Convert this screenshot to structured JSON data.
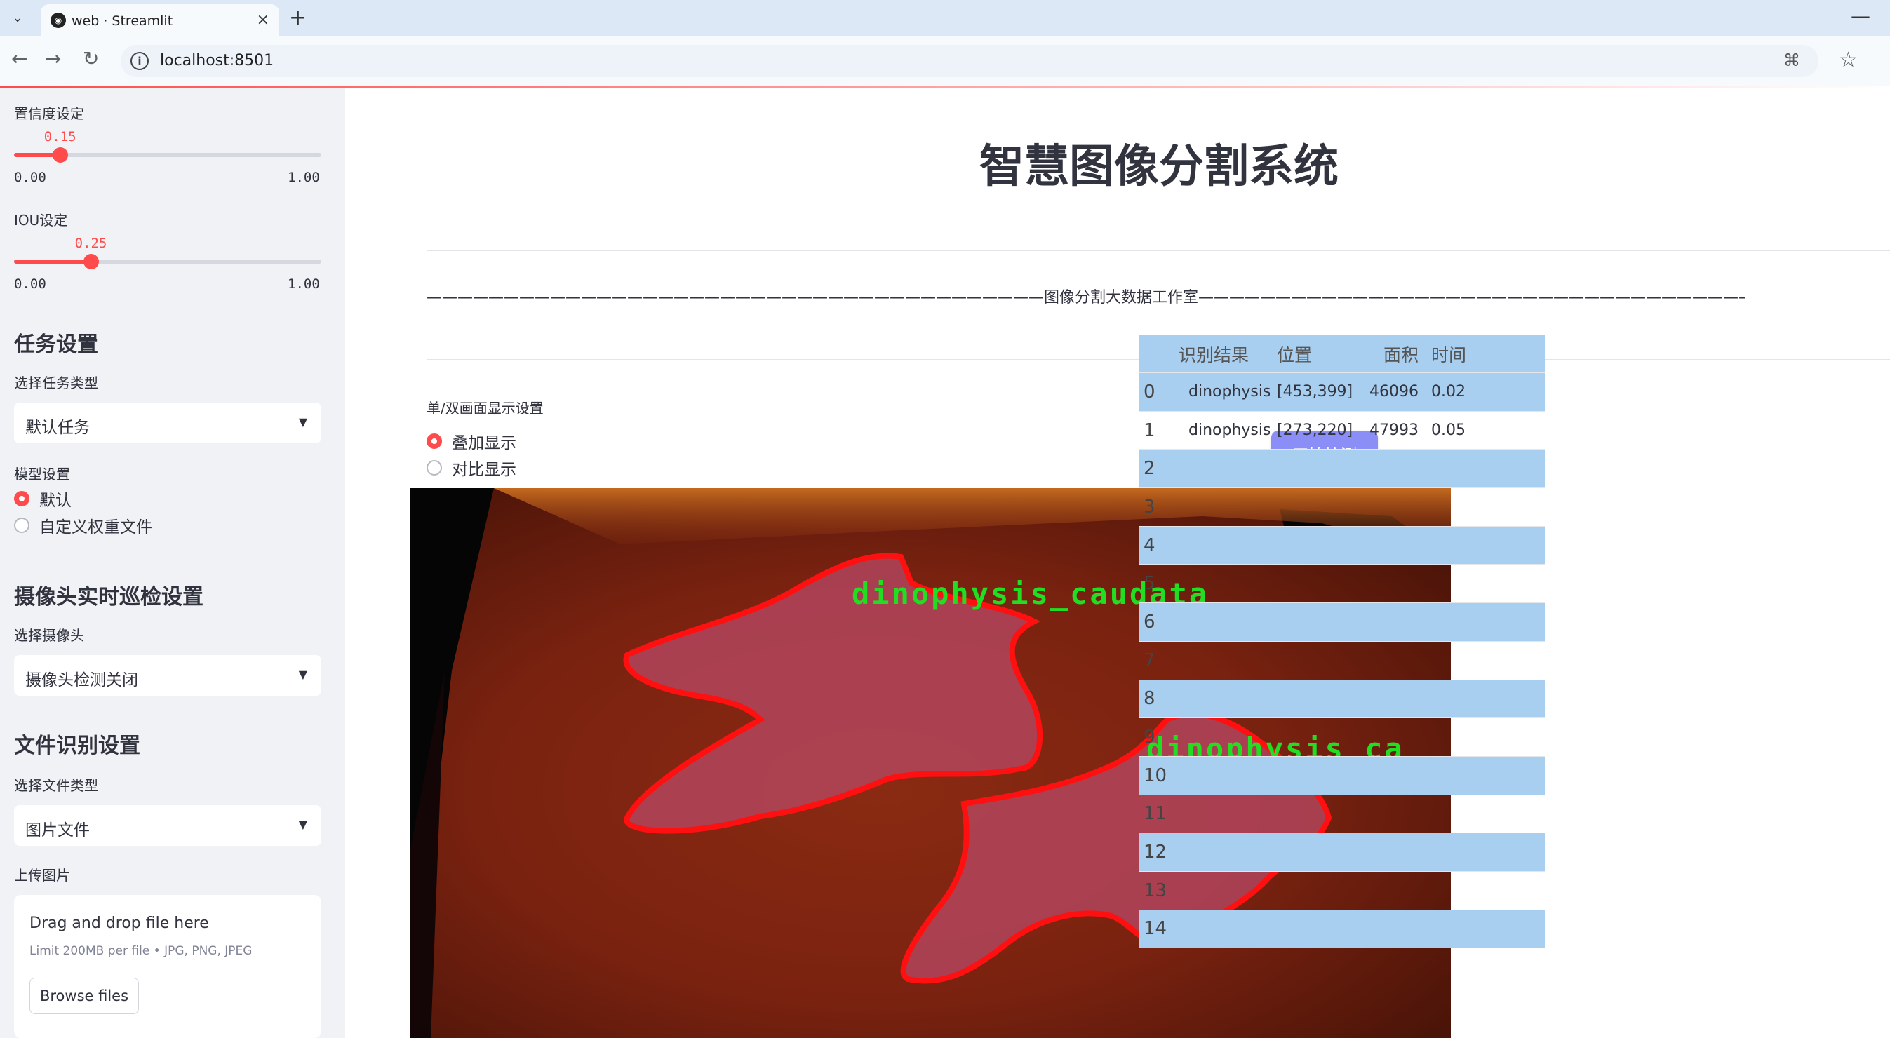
{
  "browser": {
    "tab_title": "web · Streamlit",
    "url": "localhost:8501"
  },
  "sidebar": {
    "confidence": {
      "label": "置信度设定",
      "value": 0.15,
      "value_text": "0.15",
      "min": "0.00",
      "max": "1.00"
    },
    "iou": {
      "label": "IOU设定",
      "value": 0.25,
      "value_text": "0.25",
      "min": "0.00",
      "max": "1.00"
    },
    "task_header": "任务设置",
    "task_type_label": "选择任务类型",
    "task_type_value": "默认任务",
    "model_label": "模型设置",
    "model_options": [
      "默认",
      "自定义权重文件"
    ],
    "model_selected": 0,
    "camera_header": "摄像头实时巡检设置",
    "camera_label": "选择摄像头",
    "camera_value": "摄像头检测关闭",
    "file_header": "文件识别设置",
    "file_type_label": "选择文件类型",
    "file_type_value": "图片文件",
    "upload_label": "上传图片",
    "upload_title": "Drag and drop file here",
    "upload_limit": "Limit 200MB per file • JPG, PNG, JPEG",
    "browse_label": "Browse files"
  },
  "main": {
    "title": "智慧图像分割系统",
    "banner": "————————————————————————————————————————图像分割大数据工作室————————————————————————————————————————",
    "display_label": "单/双画面显示设置",
    "display_options": [
      "叠加显示",
      "对比显示"
    ],
    "display_selected": 0,
    "start_button": "开始检测",
    "detections": [
      {
        "label": "dinophysis_caudata"
      },
      {
        "label": "dinophysis_ca"
      }
    ]
  },
  "table": {
    "headers": [
      "",
      "识别结果",
      "位置",
      "面积",
      "时间"
    ],
    "rows": [
      {
        "idx": "0",
        "result": "dinophysis_caudata",
        "position": "[453,399]",
        "area": "46096",
        "time": "0.02"
      },
      {
        "idx": "1",
        "result": "dinophysis_caudata",
        "position": "[273,220]",
        "area": "47993",
        "time": "0.05"
      },
      {
        "idx": "2",
        "result": "",
        "position": "",
        "area": "",
        "time": ""
      },
      {
        "idx": "3",
        "result": "",
        "position": "",
        "area": "",
        "time": ""
      },
      {
        "idx": "4",
        "result": "",
        "position": "",
        "area": "",
        "time": ""
      },
      {
        "idx": "5",
        "result": "",
        "position": "",
        "area": "",
        "time": ""
      },
      {
        "idx": "6",
        "result": "",
        "position": "",
        "area": "",
        "time": ""
      },
      {
        "idx": "7",
        "result": "",
        "position": "",
        "area": "",
        "time": ""
      },
      {
        "idx": "8",
        "result": "",
        "position": "",
        "area": "",
        "time": ""
      },
      {
        "idx": "9",
        "result": "",
        "position": "",
        "area": "",
        "time": ""
      },
      {
        "idx": "10",
        "result": "",
        "position": "",
        "area": "",
        "time": ""
      },
      {
        "idx": "11",
        "result": "",
        "position": "",
        "area": "",
        "time": ""
      },
      {
        "idx": "12",
        "result": "",
        "position": "",
        "area": "",
        "time": ""
      },
      {
        "idx": "13",
        "result": "",
        "position": "",
        "area": "",
        "time": ""
      },
      {
        "idx": "14",
        "result": "",
        "position": "",
        "area": "",
        "time": ""
      }
    ]
  },
  "colors": {
    "accent": "#ff4b4b",
    "button": "#8b8ef7",
    "table_stripe": "#a9cff0",
    "sidebar_bg": "#f0f2f6",
    "mask_outline": "#ff1010",
    "label_green": "#22dd22"
  },
  "icons": {
    "tab_menu": "chevron-down-icon",
    "favicon": "streamlit-icon",
    "close": "close-icon",
    "new_tab": "plus-icon",
    "back": "arrow-left-icon",
    "forward": "arrow-right-icon",
    "reload": "reload-icon",
    "site_info": "info-icon",
    "translate": "translate-icon",
    "bookmark": "star-icon",
    "select_caret": "caret-down-icon"
  }
}
